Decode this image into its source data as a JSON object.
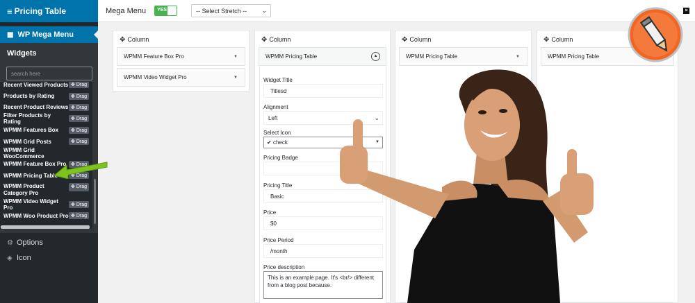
{
  "app": {
    "title": "Pricing Table",
    "menu_glyph": "≡"
  },
  "sidebar": {
    "nav_item": "WP Mega Menu",
    "widgets_title": "Widgets",
    "search_placeholder": "search here",
    "drag_label": "Drag",
    "items": [
      "Recent Viewed Products",
      "Products by Rating",
      "Recent Product Reviews",
      "Filter Products by Rating",
      "WPMM Features Box",
      "WPMM Grid Posts",
      "WPMM Grid WooCommerce",
      "WPMM Feature Box Pro",
      "WPMM Pricing Table",
      "WPMM Product Category Pro",
      "WPMM Video Widget Pro",
      "WPMM Woo Product Pro"
    ],
    "highlighted_item": "WPMM Pricing Table",
    "options_label": "Options",
    "icon_label": "Icon"
  },
  "topbar": {
    "mega_menu_label": "Mega Menu",
    "toggle_label": "YES",
    "stretch_select": "-- Select Stretch --",
    "close_glyph": "×"
  },
  "columns": {
    "label": "Column",
    "col1_widgets": [
      "WPMM Feature Box Pro",
      "WPMM Video Widget Pro"
    ],
    "col2_widget": "WPMM Pricing Table",
    "col3_widget": "WPMM Pricing Table",
    "col4_widget": "WPMM Pricing Table"
  },
  "form": {
    "widget_title_label": "Widget Title",
    "widget_title_value": "Titlesd",
    "alignment_label": "Alignment",
    "alignment_value": "Left",
    "select_icon_label": "Select Icon",
    "select_icon_value": "check",
    "pricing_badge_label": "Pricing Badge",
    "pricing_badge_value": "",
    "pricing_title_label": "Pricing Title",
    "pricing_title_value": "Basic",
    "price_label": "Price",
    "price_value": "$0",
    "price_period_label": "Price Period",
    "price_period_value": "/month",
    "price_description_label": "Price description",
    "price_description_value": "This is an example page. It's <br/> different from a blog post because."
  },
  "colors": {
    "sidebar_bg": "#23282d",
    "accent": "#0073aa",
    "toggle_green": "#46b450",
    "arrow_green": "#7dc21e",
    "badge_orange": "#f26522"
  }
}
